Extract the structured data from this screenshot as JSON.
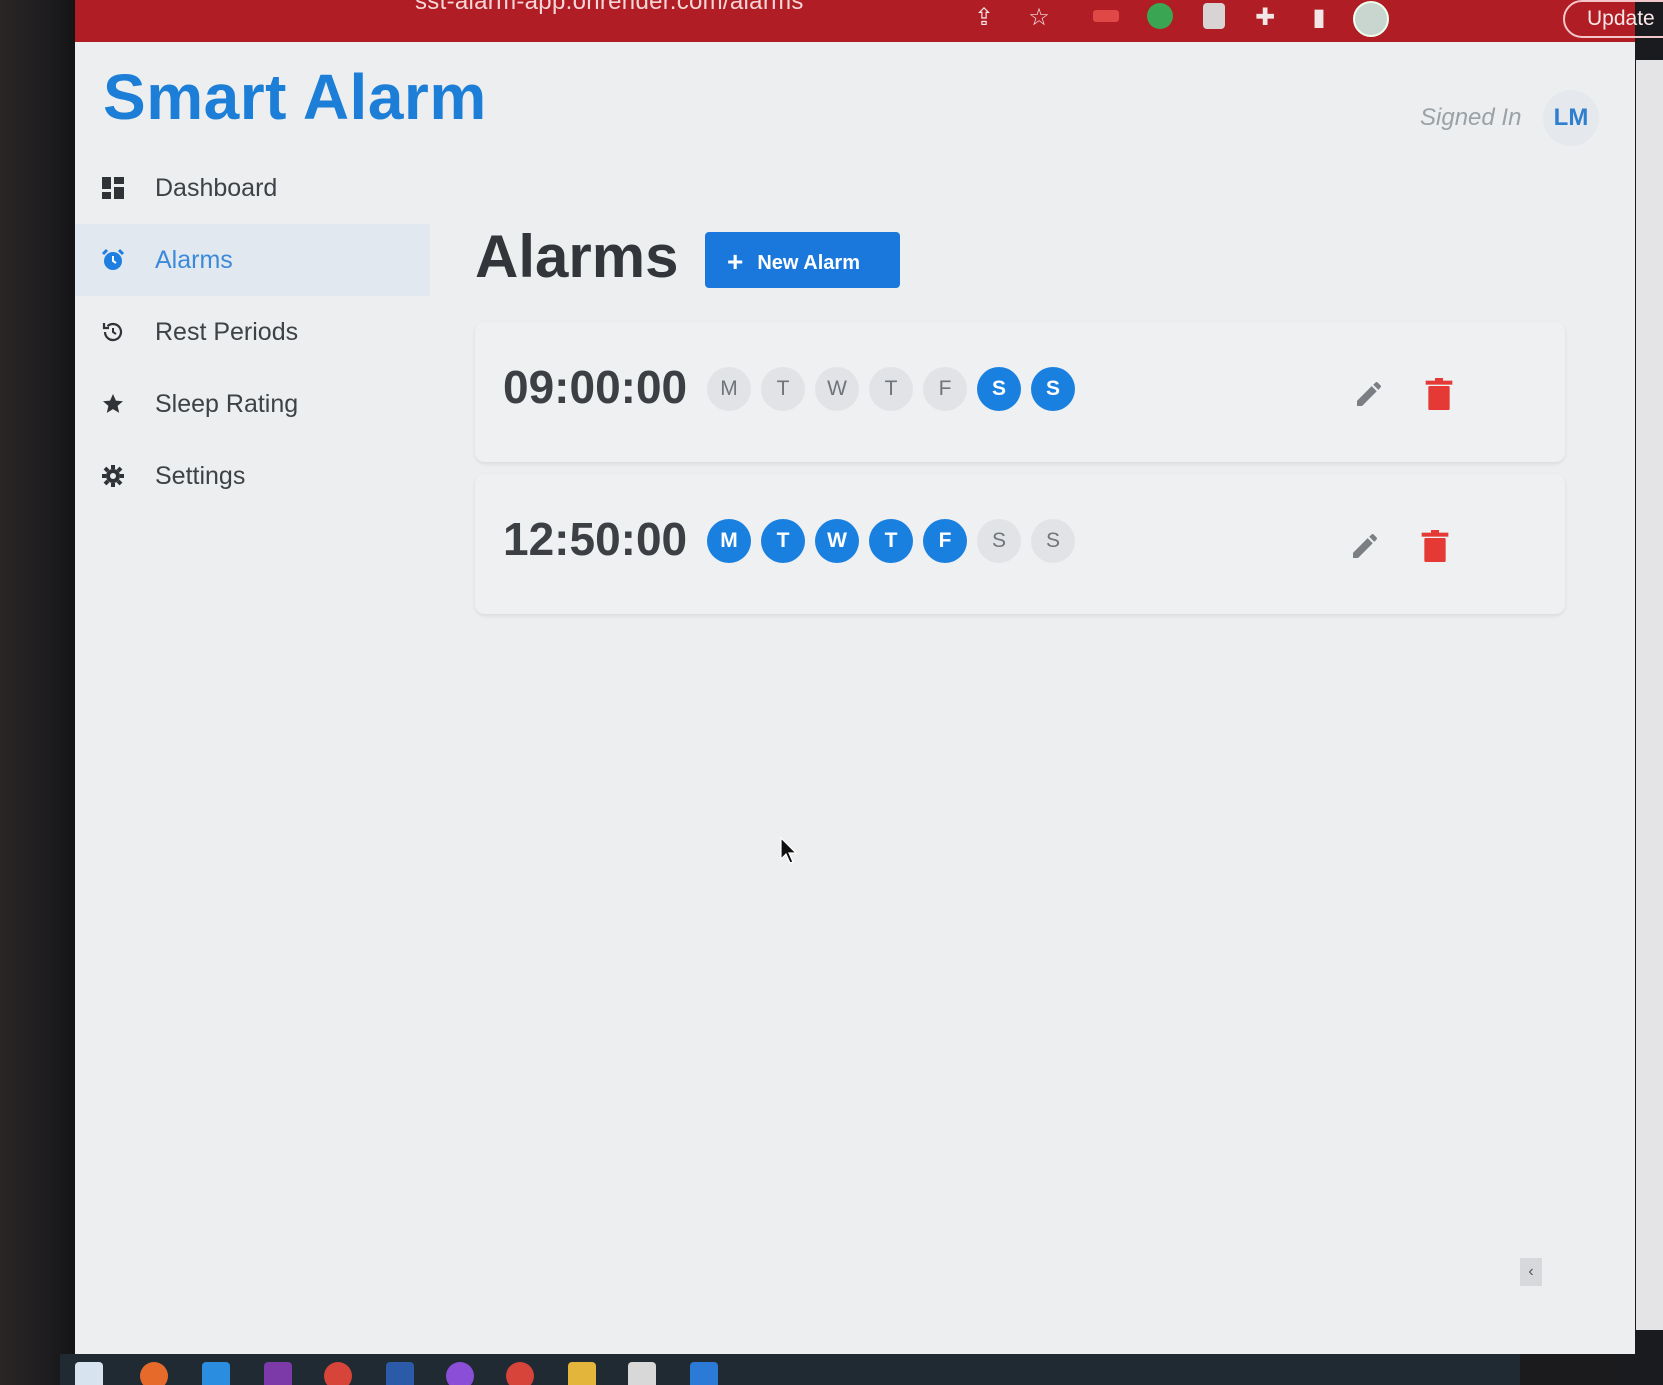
{
  "browser": {
    "url": "sst-alarm-app.onrender.com/alarms",
    "update_label": "Update"
  },
  "app": {
    "title": "Smart Alarm",
    "signed_in_label": "Signed In",
    "user_initials": "LM"
  },
  "sidebar": {
    "items": [
      {
        "label": "Dashboard",
        "icon": "dashboard-icon",
        "active": false
      },
      {
        "label": "Alarms",
        "icon": "alarm-clock-icon",
        "active": true
      },
      {
        "label": "Rest Periods",
        "icon": "history-icon",
        "active": false
      },
      {
        "label": "Sleep Rating",
        "icon": "star-icon",
        "active": false
      },
      {
        "label": "Settings",
        "icon": "gear-icon",
        "active": false
      }
    ]
  },
  "main": {
    "heading": "Alarms",
    "new_alarm_label": "New Alarm",
    "alarms": [
      {
        "time": "09:00:00",
        "days": [
          {
            "label": "M",
            "on": false
          },
          {
            "label": "T",
            "on": false
          },
          {
            "label": "W",
            "on": false
          },
          {
            "label": "T",
            "on": false
          },
          {
            "label": "F",
            "on": false
          },
          {
            "label": "S",
            "on": true
          },
          {
            "label": "S",
            "on": true
          }
        ]
      },
      {
        "time": "12:50:00",
        "days": [
          {
            "label": "M",
            "on": true
          },
          {
            "label": "T",
            "on": true
          },
          {
            "label": "W",
            "on": true
          },
          {
            "label": "T",
            "on": true
          },
          {
            "label": "F",
            "on": true
          },
          {
            "label": "S",
            "on": false
          },
          {
            "label": "S",
            "on": false
          }
        ]
      }
    ]
  },
  "colors": {
    "brand_blue": "#1c7ed6",
    "day_on": "#1a80e0",
    "delete_red": "#e53935",
    "browser_red": "#b01d24"
  }
}
